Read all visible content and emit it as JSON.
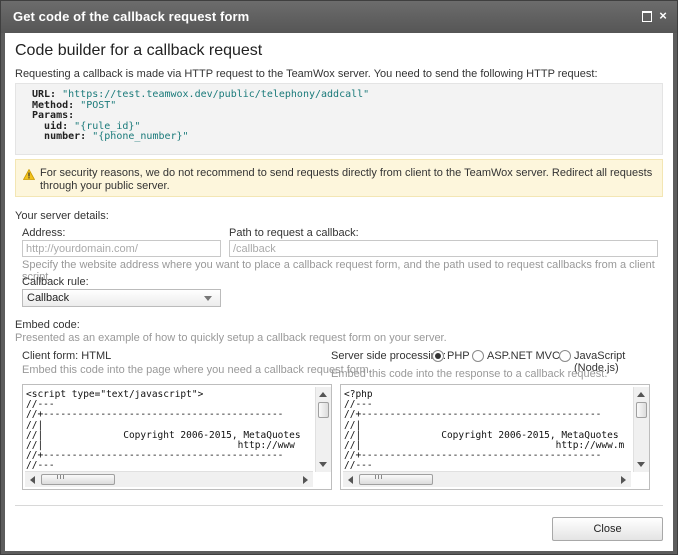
{
  "window": {
    "title": "Get code of the callback request form",
    "maximize_icon": "maximize-icon",
    "close_glyph": "×"
  },
  "heading": "Code builder for a callback request",
  "intro": "Requesting a callback is made via HTTP request to the TeamWox server. You need to send the following HTTP request:",
  "request": {
    "url_key": "URL:",
    "url_value": "\"https://test.teamwox.dev/public/telephony/addcall\"",
    "method_key": "Method:",
    "method_value": "\"POST\"",
    "params_key": "Params:",
    "uid_key": "uid:",
    "uid_value": "\"{rule_id}\"",
    "number_key": "number:",
    "number_value": "\"{phone_number}\""
  },
  "warning": {
    "icon": "warning-icon",
    "text": "For security reasons, we do not recommend to send requests directly from client to the TeamWox server. Redirect all requests through your public server."
  },
  "server": {
    "section_label": "Your server details:",
    "address_label": "Address:",
    "address_placeholder": "http://yourdomain.com/",
    "path_label": "Path to request a callback:",
    "path_placeholder": "/callback",
    "hint": "Specify the website address where you want to place a callback request form, and the path used to request callbacks from a client script.",
    "rule_label": "Callback rule:",
    "rule_value": "Callback"
  },
  "embed": {
    "section_label": "Embed code:",
    "hint": "Presented as an example of how to quickly setup a callback request form on your server.",
    "client_label": "Client form: HTML",
    "client_hint": "Embed this code into the page where you need a callback request form.",
    "server_label": "Server side processing:",
    "options": [
      "PHP",
      "ASP.NET MVC",
      "JavaScript (Node.js)"
    ],
    "selected_option": "PHP",
    "server_hint": "Embed this code into the response to a callback request.",
    "client_code": "<script type=\"text/javascript\">\n//---\n//+------------------------------------------\n//|\n//|              Copyright 2006-2015, MetaQuotes\n//|                                  http://www\n//+------------------------------------------\n//---",
    "server_code": "<?php\n//---\n//+------------------------------------------\n//|\n//|              Copyright 2006-2015, MetaQuotes\n//|                                  http://www.m\n//+------------------------------------------\n//---"
  },
  "footer": {
    "close_label": "Close"
  },
  "colors": {
    "titlebar": "#5d5d5d",
    "warning_bg": "#fdf6dc",
    "code_bg": "#f3f3f3",
    "string_color": "#1a7a7a"
  }
}
